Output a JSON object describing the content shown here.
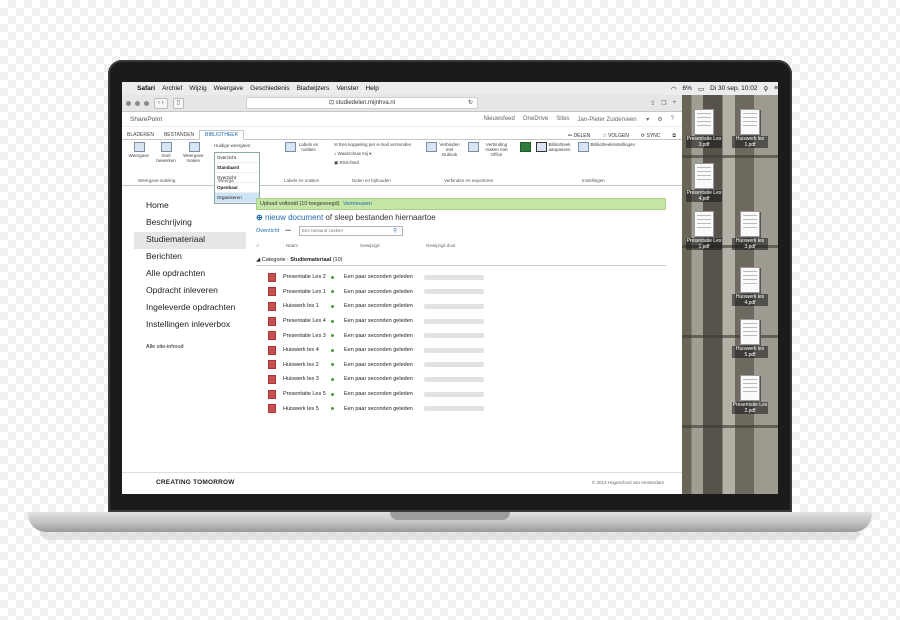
{
  "menubar": {
    "apple": "",
    "app": "Safari",
    "items": [
      "Archief",
      "Wijzig",
      "Weergave",
      "Geschiedenis",
      "Bladwijzers",
      "Venster",
      "Help"
    ],
    "battery": "6%",
    "clock": "Di 30 sep.  10:02"
  },
  "safari": {
    "url": "studiedelen.mijnhva.nl"
  },
  "suitebar": {
    "title": "SharePoint",
    "links": [
      "Nieuwsfeed",
      "OneDrive",
      "Sites"
    ],
    "user": "Jan-Pieter Zuiderveen",
    "settings_icon": "gear-icon",
    "help": "?"
  },
  "tabs": [
    "BLADEREN",
    "BESTANDEN",
    "BIBLIOTHEEK"
  ],
  "tab_actions": [
    "DELEN",
    "VOLGEN",
    "SYNC"
  ],
  "ribbon": {
    "weergave": "Weergave",
    "snel_bewerken": "Snel bewerken",
    "weergave_maken": "Weergave maken",
    "current_view_label": "Huidige weergave:",
    "current_view_value": "Overzicht",
    "view_options": [
      "Standaard",
      "Overzicht",
      "Openbaar",
      "Organiseren"
    ],
    "group_weergave_indeling": "Weergave-indeling",
    "group_weergaven": "Weerga",
    "labels_notities": "Labels en notities",
    "group_labels": "Labels en notities",
    "email_link": "Een koppeling per e-mail verzenden",
    "waarschuw": "Waarschuw mij",
    "rss": "RSS-feed",
    "group_delen": "Delen en bijhouden",
    "outlook": "Verbinden met Outlook",
    "office": "Verbinding maken met Office",
    "group_verbinden": "Verbinden en exporteren",
    "bibliotheek_aanpassen": "Bibliotheek aanpassen",
    "bibliotheekinstellingen": "Bibliotheekinstellingen",
    "group_instellingen": "Instellingen"
  },
  "leftnav": {
    "items": [
      "Home",
      "Beschrijving",
      "Studiemateriaal",
      "Berichten",
      "Alle opdrachten",
      "Opdracht inleveren",
      "Ingeleverde opdrachten",
      "Instellingen inleverbox"
    ],
    "selected": "Studiemateriaal",
    "site_contents": "Alle site-inhoud"
  },
  "main": {
    "banner": "Upload voltooid (10 toegevoegd)",
    "banner_link": "Vernieuwen",
    "new_doc_plus": "⊕",
    "new_doc": "nieuw document",
    "new_doc_rest": " of sleep bestanden hiernaartoe",
    "view_link": "Overzicht",
    "more": "•••",
    "search_placeholder": "Een bestand zoeken",
    "col_check": "✓",
    "col_name": "Naam",
    "col_modified": "Gewijzigd",
    "col_modified_by": "Gewijzigd door",
    "category_prefix": "Categorie : ",
    "category_name": "Studiemateriaal",
    "category_count": "(10)",
    "files": [
      {
        "name": "Presentatie Les 2",
        "modified": "Een paar seconden geleden"
      },
      {
        "name": "Presentatie Les 1",
        "modified": "Een paar seconden geleden"
      },
      {
        "name": "Huiswerk les 1",
        "modified": "Een paar seconden geleden"
      },
      {
        "name": "Presentatie Les 4",
        "modified": "Een paar seconden geleden"
      },
      {
        "name": "Presentatie Les 3",
        "modified": "Een paar seconden geleden"
      },
      {
        "name": "Huiswerk les 4",
        "modified": "Een paar seconden geleden"
      },
      {
        "name": "Huiswerk les 2",
        "modified": "Een paar seconden geleden"
      },
      {
        "name": "Huiswerk les 3",
        "modified": "Een paar seconden geleden"
      },
      {
        "name": "Presentatie Les 5",
        "modified": "Een paar seconden geleden"
      },
      {
        "name": "Huiswerk les 5",
        "modified": "Een paar seconden geleden"
      }
    ]
  },
  "footer": {
    "brand": "CREATING TOMORROW",
    "copyright": "© 2014 Hogeschool van Amsterdam"
  },
  "desktop_files": [
    {
      "label": "Presentatie Les 3.pdf"
    },
    {
      "label": "Huiswerk les 1.pdf"
    },
    {
      "label": "Presentatie Les 4.pdf"
    },
    {
      "label": "Huiswerk les 3.pdf"
    },
    {
      "label": "Presentatie Les 1.pdf"
    },
    {
      "label": "Huiswerk les 4.pdf"
    },
    {
      "label": "Huiswerk les 5.pdf"
    },
    {
      "label": "Presentatie Les 2.pdf"
    }
  ],
  "colors": {
    "accent": "#1e6ab0",
    "banner": "#c5e5a5",
    "doc_icon": "#c75050"
  }
}
